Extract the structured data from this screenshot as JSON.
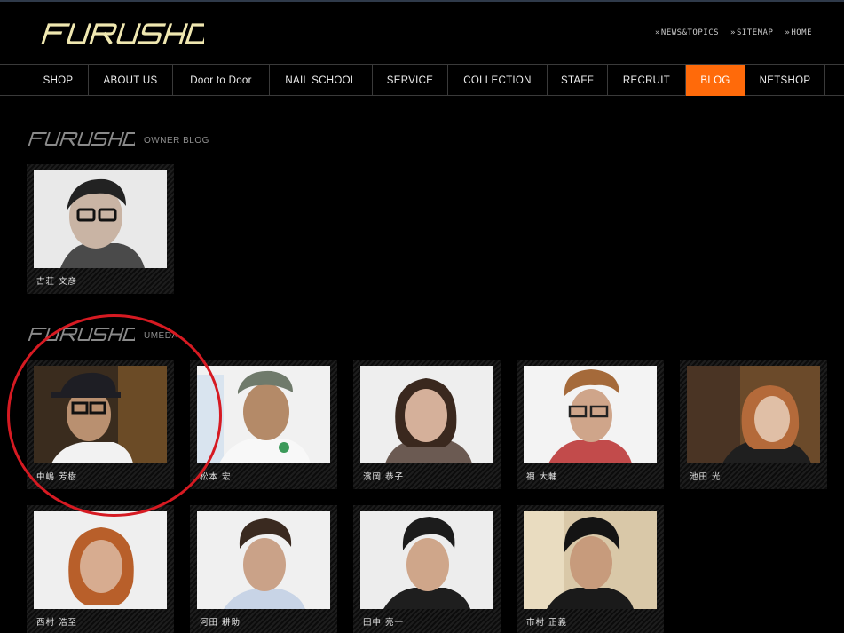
{
  "header": {
    "logo_text": "FURUSHO",
    "links": [
      {
        "label": "NEWS&TOPICS",
        "chevron": "»"
      },
      {
        "label": "SITEMAP",
        "chevron": "»"
      },
      {
        "label": "HOME",
        "chevron": "»"
      }
    ]
  },
  "nav": {
    "items": [
      {
        "label": "SHOP"
      },
      {
        "label": "ABOUT US"
      },
      {
        "label": "Door to Door"
      },
      {
        "label": "NAIL SCHOOL"
      },
      {
        "label": "SERVICE"
      },
      {
        "label": "COLLECTION"
      },
      {
        "label": "STAFF"
      },
      {
        "label": "RECRUIT"
      },
      {
        "label": "BLOG",
        "active": true
      },
      {
        "label": "NETSHOP"
      }
    ]
  },
  "sections": [
    {
      "logo_text": "FURUSHO",
      "label": "OWNER BLOG"
    },
    {
      "logo_text": "FURUSHO",
      "label": "UMEDA"
    }
  ],
  "owner": [
    {
      "name": "古荘 文彦"
    }
  ],
  "staff": [
    {
      "name": "中嶋 芳樹"
    },
    {
      "name": "松本 宏"
    },
    {
      "name": "濱岡 恭子"
    },
    {
      "name": "禰 大輔"
    },
    {
      "name": "池田 光"
    },
    {
      "name": "西村 浩至"
    },
    {
      "name": "河田 耕助"
    },
    {
      "name": "田中 亮一"
    },
    {
      "name": "市村 正義"
    }
  ],
  "colors": {
    "accent": "#ff6a0a",
    "annotation_circle": "#d61a22"
  }
}
